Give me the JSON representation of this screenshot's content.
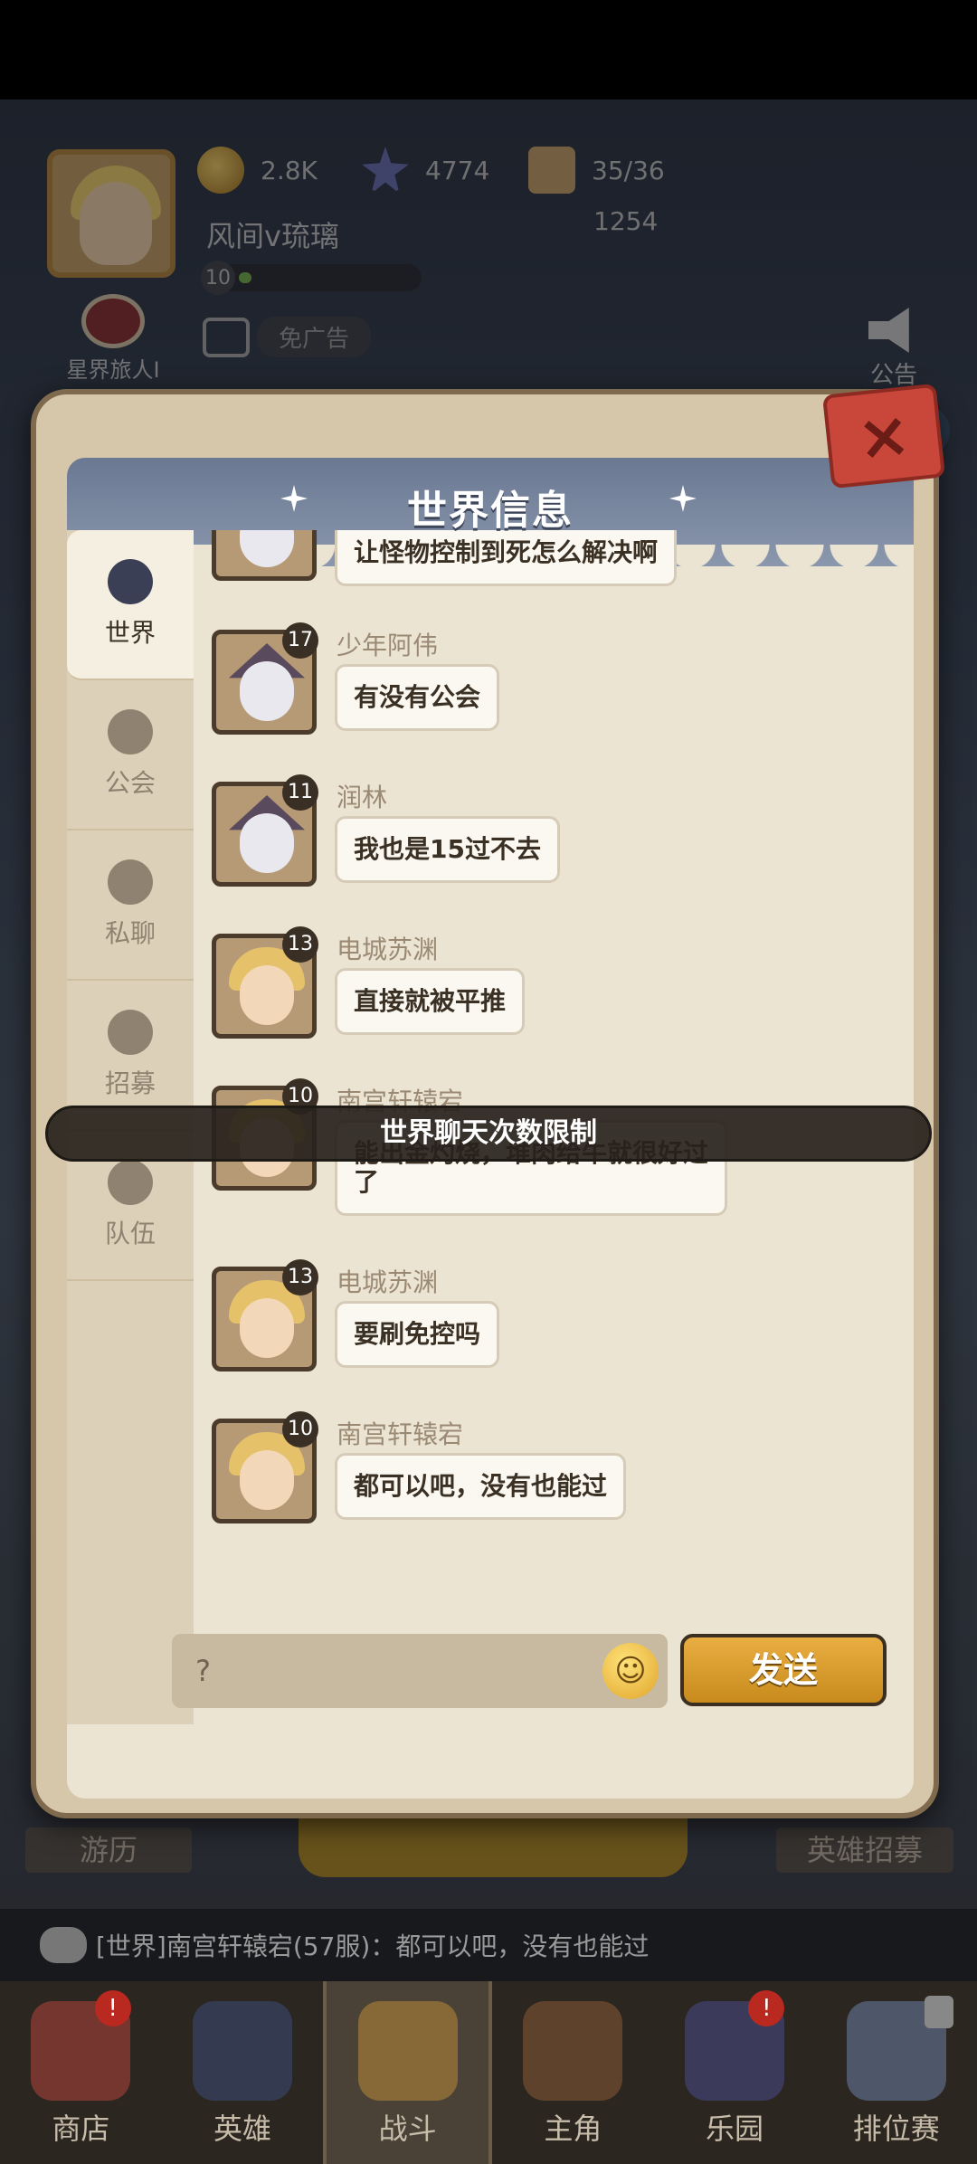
{
  "hud": {
    "coins": "2.8K",
    "stars": "4774",
    "stamina": "35/36",
    "stamina_timer": "1254",
    "player_name": "风间v琉璃",
    "level": "10",
    "no_ad_label": "免广告",
    "title_label": "星界旅人I",
    "notice_label": "公告",
    "left_button": "游历",
    "right_button": "英雄招募"
  },
  "dialog": {
    "title": "世界信息",
    "close_icon": "×",
    "tabs": [
      {
        "label": "世界",
        "icon": "planet-icon"
      },
      {
        "label": "公会",
        "icon": "guild-icon"
      },
      {
        "label": "私聊",
        "icon": "chat-bubble-icon"
      },
      {
        "label": "招募",
        "icon": "flag-icon"
      },
      {
        "label": "队伍",
        "icon": "team-icon"
      }
    ],
    "messages": [
      {
        "name": "",
        "level": "",
        "text": "让怪物控制到死怎么解决啊",
        "avatar": "wizard"
      },
      {
        "name": "少年阿伟",
        "level": "17",
        "text": "有没有公会",
        "avatar": "wizard"
      },
      {
        "name": "润林",
        "level": "11",
        "text": "我也是15过不去",
        "avatar": "wizard"
      },
      {
        "name": "电城苏渊",
        "level": "13",
        "text": "直接就被平推",
        "avatar": "blonde"
      },
      {
        "name": "南宫轩辕宕",
        "level": "10",
        "text": "能出金灼烧，堆肉给牛就很好过了",
        "avatar": "blonde"
      },
      {
        "name": "电城苏渊",
        "level": "13",
        "text": "要刷免控吗",
        "avatar": "blonde"
      },
      {
        "name": "南宫轩辕宕",
        "level": "10",
        "text": "都可以吧，没有也能过",
        "avatar": "blonde"
      }
    ],
    "limit_banner": "世界聊天次数限制",
    "input_value": "?",
    "send_label": "发送"
  },
  "ticker": "[世界]南宫轩辕宕(57服)：都可以吧，没有也能过",
  "nav": [
    {
      "label": "商店",
      "badge": "!"
    },
    {
      "label": "英雄",
      "badge": ""
    },
    {
      "label": "战斗",
      "badge": ""
    },
    {
      "label": "主角",
      "badge": ""
    },
    {
      "label": "乐园",
      "badge": "!"
    },
    {
      "label": "排位赛",
      "badge": ""
    }
  ]
}
